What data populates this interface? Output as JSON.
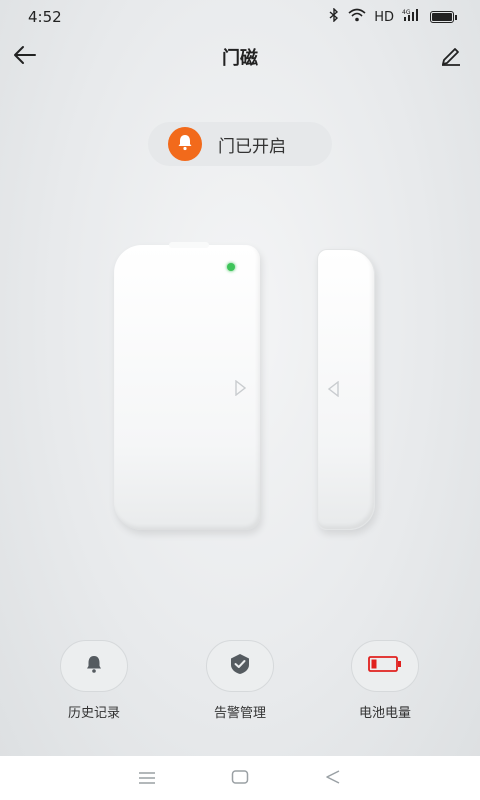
{
  "status_bar": {
    "time": "4:52",
    "network": "HD",
    "signal": "4G"
  },
  "app_bar": {
    "title": "门磁"
  },
  "door_status": {
    "text": "门已开启",
    "accent_color": "#f26a1b"
  },
  "device": {
    "led_color": "#3ec45a"
  },
  "actions": [
    {
      "label": "历史记录",
      "icon": "bell-icon"
    },
    {
      "label": "告警管理",
      "icon": "shield-check-icon"
    },
    {
      "label": "电池电量",
      "icon": "battery-low-icon",
      "battery_color": "#e0201e"
    }
  ],
  "nav": [
    "menu-icon",
    "home-icon",
    "back-triangle-icon"
  ]
}
